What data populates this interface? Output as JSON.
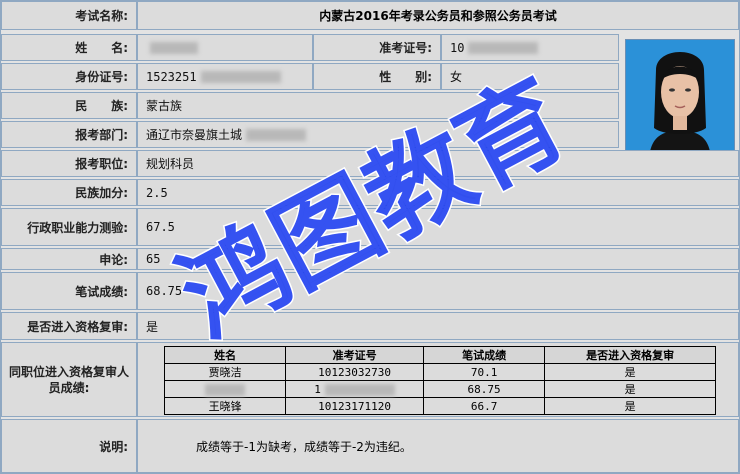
{
  "exam": {
    "label": "考试名称:",
    "value": "内蒙古2016年考录公务员和参照公务员考试"
  },
  "name": {
    "label": "姓　　名:",
    "value": ""
  },
  "ticket": {
    "label": "准考证号:",
    "value": "10"
  },
  "id_card": {
    "label": "身份证号:",
    "value": "1523251"
  },
  "gender": {
    "label": "性　　别:",
    "value": "女"
  },
  "ethnicity": {
    "label": "民　　族:",
    "value": "蒙古族"
  },
  "department": {
    "label": "报考部门:",
    "value": "通辽市奈曼旗土城"
  },
  "position": {
    "label": "报考职位:",
    "value": "规划科员"
  },
  "ethnic_bonus": {
    "label": "民族加分:",
    "value": "2.5"
  },
  "aptitude": {
    "label": "行政职业能力测验:",
    "value": "67.5"
  },
  "essay": {
    "label": "申论:",
    "value": "65"
  },
  "written": {
    "label": "笔试成绩:",
    "value": "68.75"
  },
  "qualify": {
    "label": "是否进入资格复审:",
    "value": "是"
  },
  "peers": {
    "label": "同职位进入资格复审人员成绩:",
    "headers": [
      "姓名",
      "准考证号",
      "笔试成绩",
      "是否进入资格复审"
    ],
    "rows": [
      [
        "贾晓洁",
        "10123032730",
        "70.1",
        "是"
      ],
      [
        "",
        "1",
        "68.75",
        "是"
      ],
      [
        "王晓锋",
        "10123171120",
        "66.7",
        "是"
      ]
    ]
  },
  "note": {
    "label": "说明:",
    "value": "成绩等于-1为缺考，成绩等于-2为违纪。"
  },
  "watermark": {
    "text": "鸿图教育",
    "color": "#1f3ff0"
  },
  "colors": {
    "border": "#8fa8c2",
    "cell_bg": "#dcdcdc",
    "photo_bg": "#2a8fd4"
  }
}
